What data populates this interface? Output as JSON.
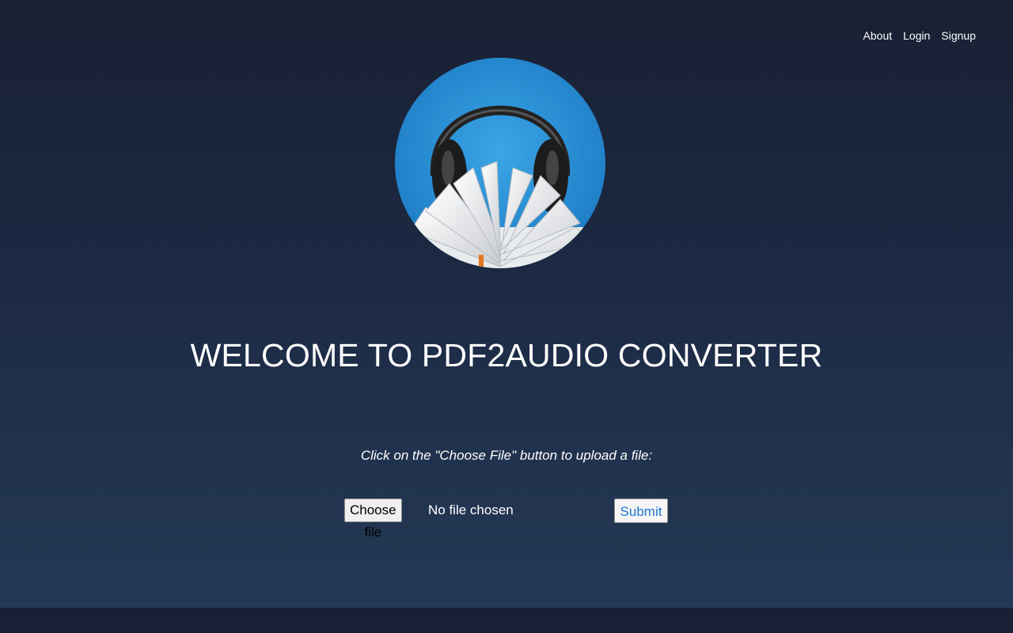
{
  "nav": {
    "about": "About",
    "login": "Login",
    "signup": "Signup"
  },
  "logo": {
    "icon": "headphones-book-logo",
    "colors": {
      "circle": "#2a8fd4",
      "headphones": "#1a1a1a",
      "pages": "#f2f2f2"
    }
  },
  "main": {
    "title": "WELCOME TO PDF2AUDIO CONVERTER",
    "instructions": "Click on the \"Choose File\" button to upload a file:"
  },
  "upload": {
    "choose_label": "Choose file",
    "status": "No file chosen",
    "submit_label": "Submit"
  },
  "colors": {
    "background_top": "#182033",
    "background_bottom": "#243a57",
    "submit_text": "#1f76d3",
    "footer": "#172034"
  }
}
